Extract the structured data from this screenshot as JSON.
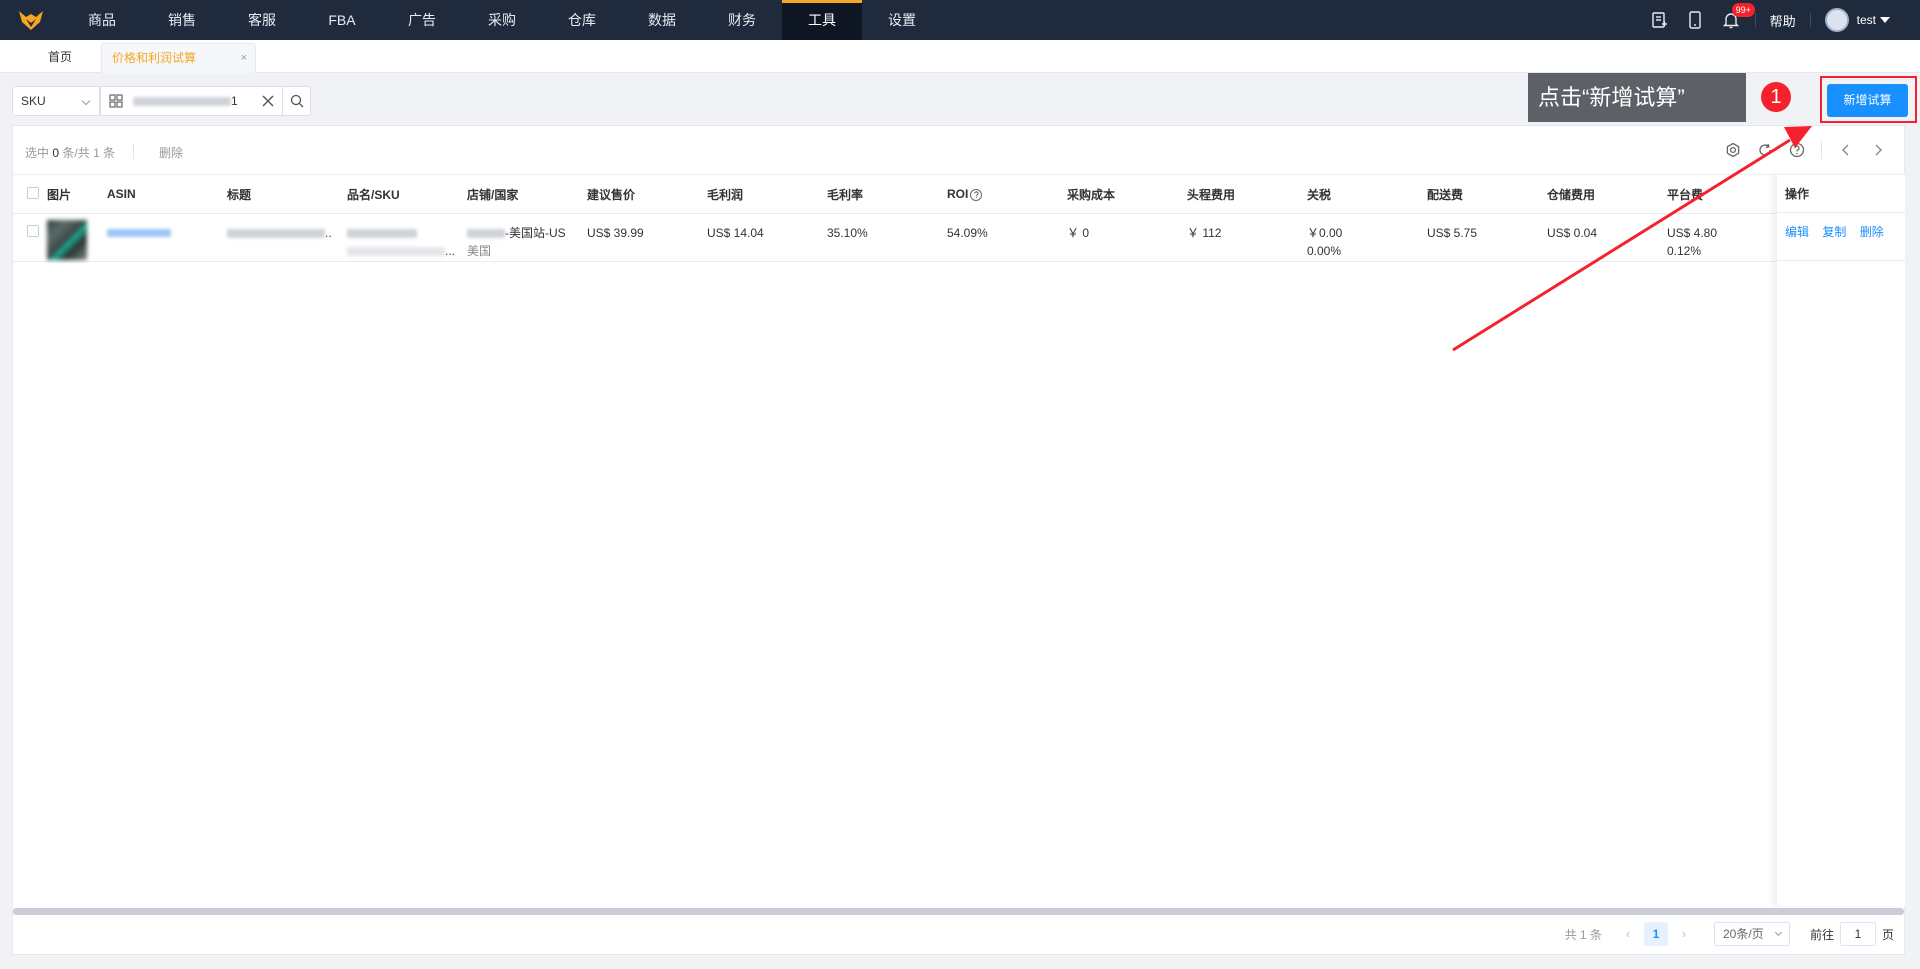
{
  "nav": {
    "items": [
      "商品",
      "销售",
      "客服",
      "FBA",
      "广告",
      "采购",
      "仓库",
      "数据",
      "财务",
      "工具",
      "设置"
    ],
    "active_index": 9,
    "badge": "99+",
    "help": "帮助",
    "user": "test"
  },
  "tabs": {
    "home": "首页",
    "active": "价格和利润试算",
    "close": "×"
  },
  "filter": {
    "type": "SKU",
    "search_tail": "1"
  },
  "callout": {
    "text": "点击“新增试算”",
    "step": "1"
  },
  "new_button": "新增试算",
  "toolbar": {
    "sel_prefix": "选中",
    "sel_count": "0",
    "sel_suffix": "条/共",
    "total": "1",
    "unit": "条",
    "delete": "删除"
  },
  "table": {
    "headers": [
      "图片",
      "ASIN",
      "标题",
      "品名/SKU",
      "店铺/国家",
      "建议售价",
      "毛利润",
      "毛利率",
      "ROI",
      "采购成本",
      "头程费用",
      "关税",
      "配送费",
      "仓储费用",
      "平台费"
    ],
    "ops_header": "操作",
    "row": {
      "store": "-美国站-US",
      "country": "美国",
      "price": "US$ 39.99",
      "gross_profit": "US$ 14.04",
      "margin": "35.10%",
      "roi": "54.09%",
      "purchase": "￥ 0",
      "first_leg": "￥ 112",
      "tariff": "￥0.00",
      "tariff_rate": "0.00%",
      "delivery": "US$ 5.75",
      "storage": "US$ 0.04",
      "platform": "US$ 4.80",
      "platform_rate": "0.12%",
      "title_tail": "..",
      "sku_tail": "..."
    },
    "ops": [
      "编辑",
      "复制",
      "删除"
    ]
  },
  "pager": {
    "total_prefix": "共",
    "total": "1",
    "total_unit": "条",
    "page": "1",
    "page_size": "20条/页",
    "goto": "前往",
    "goto_value": "1",
    "goto_unit": "页"
  },
  "colors": {
    "nav_bg": "#1f2a3d",
    "accent": "#f5a623",
    "primary": "#1890ff",
    "annotation_red": "#f5222d"
  }
}
